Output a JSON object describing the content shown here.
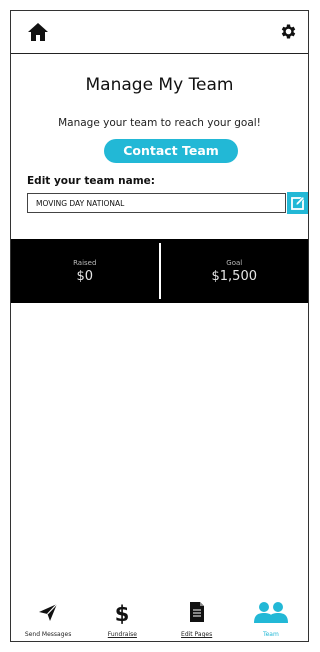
{
  "colors": {
    "accent": "#22b8d6",
    "stats_bg": "#000000"
  },
  "header": {
    "home_icon": "home-icon",
    "settings_icon": "gear-icon"
  },
  "main": {
    "title": "Manage My Team",
    "subtitle": "Manage your team to reach your goal!",
    "contact_button_label": "Contact Team",
    "edit_label": "Edit your team name:",
    "team_name_value": "MOVING DAY NATIONAL",
    "edit_icon": "edit-icon"
  },
  "stats": {
    "raised_label": "Raised",
    "raised_value": "$0",
    "goal_label": "Goal",
    "goal_value": "$1,500"
  },
  "nav": {
    "items": [
      {
        "label": "Send Messages",
        "icon": "send-icon"
      },
      {
        "label": "Fundraise",
        "icon": "dollar-icon"
      },
      {
        "label": "Edit Pages",
        "icon": "document-icon"
      },
      {
        "label": "Team",
        "icon": "team-icon",
        "active": true
      }
    ]
  }
}
